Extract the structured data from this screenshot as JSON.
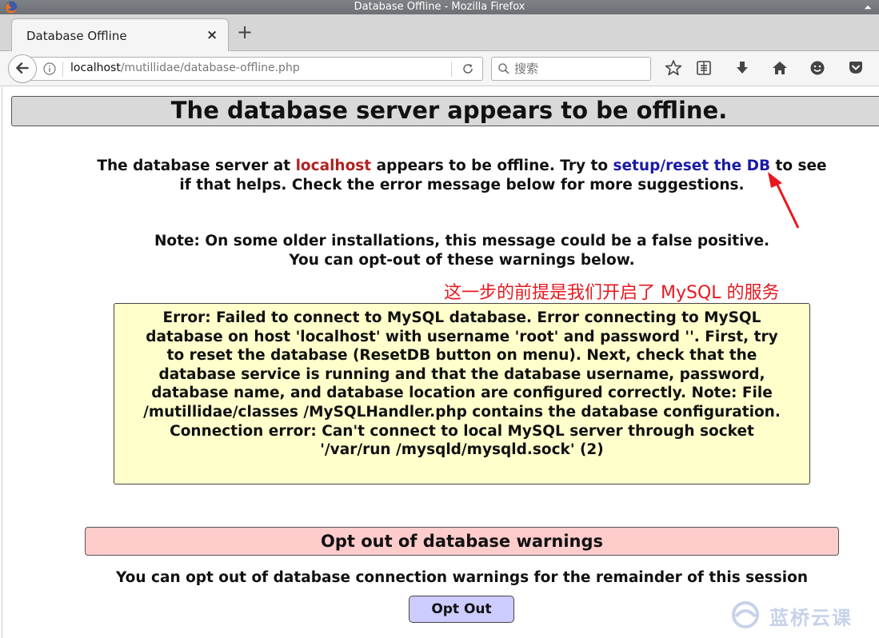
{
  "window": {
    "title": "Database Offline - Mozilla Firefox"
  },
  "tab": {
    "title": "Database Offline",
    "close_glyph": "×",
    "new_tab_glyph": "+"
  },
  "navbar": {
    "url_host": "localhost",
    "url_path": "/mutillidae/database-offline.php",
    "search_placeholder": "搜索"
  },
  "page": {
    "title": "The database server appears to be offline.",
    "intro": {
      "before_host": "The database server at ",
      "host": "localhost",
      "middle": " appears to be offline. Try to ",
      "link": "setup/reset the DB",
      "after": " to see if that helps. Check the error message below for more suggestions."
    },
    "note": {
      "line1": "Note: On some older installations, this message could be a false positive.",
      "line2": "You can opt-out of these warnings below."
    },
    "error_message": "Error: Failed to connect to MySQL database. Error connecting to MySQL database on host 'localhost' with username 'root' and password ''. First, try to reset the database (ResetDB button on menu). Next, check that the database service is running and that the database username, password, database name, and database location are configured correctly. Note: File /mutillidae/classes /MySQLHandler.php contains the database configuration. Connection error: Can't connect to local MySQL server through socket '/var/run /mysqld/mysqld.sock' (2)",
    "optout": {
      "header": "Opt out of database warnings",
      "description": "You can opt out of database connection warnings for the remainder of this session",
      "button_label": "Opt Out"
    }
  },
  "annotation": {
    "text": "这一步的前提是我们开启了 MySQL 的服务",
    "color": "#e8181e"
  },
  "watermark": {
    "text": "蓝桥云课"
  },
  "colors": {
    "title_bg": "#d9d9d9",
    "error_bg": "#ffffcc",
    "optout_header_bg": "#ffcccc",
    "optout_button_bg": "#ccccff",
    "host_text": "#b22222",
    "link_text": "#1a1aa6"
  }
}
